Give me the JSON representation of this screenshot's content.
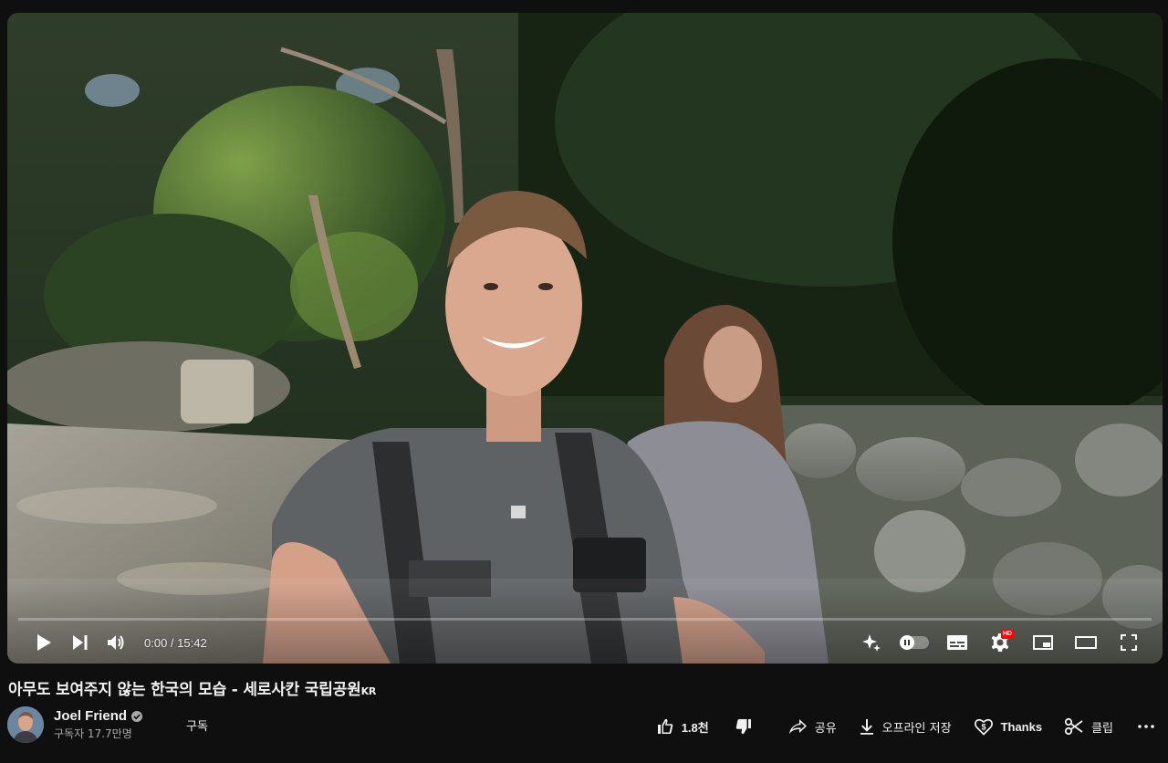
{
  "player": {
    "time_current": "0:00",
    "time_separator": " / ",
    "time_total": "15:42",
    "progress": 0,
    "hd_badge": "HD",
    "accent_color": "#ff0000"
  },
  "video": {
    "title": "아무도 보여주지 않는 한국의 모습 - 세로사칸 국립공원",
    "title_suffix": "KR"
  },
  "owner": {
    "channel_name": "Joel Friend",
    "subscriber_count": "구독자 17.7만명",
    "subscribe_label": "구독"
  },
  "actions": {
    "like_count": "1.8천",
    "share_label": "공유",
    "download_label": "오프라인 저장",
    "thanks_label": "Thanks",
    "clip_label": "클립"
  }
}
